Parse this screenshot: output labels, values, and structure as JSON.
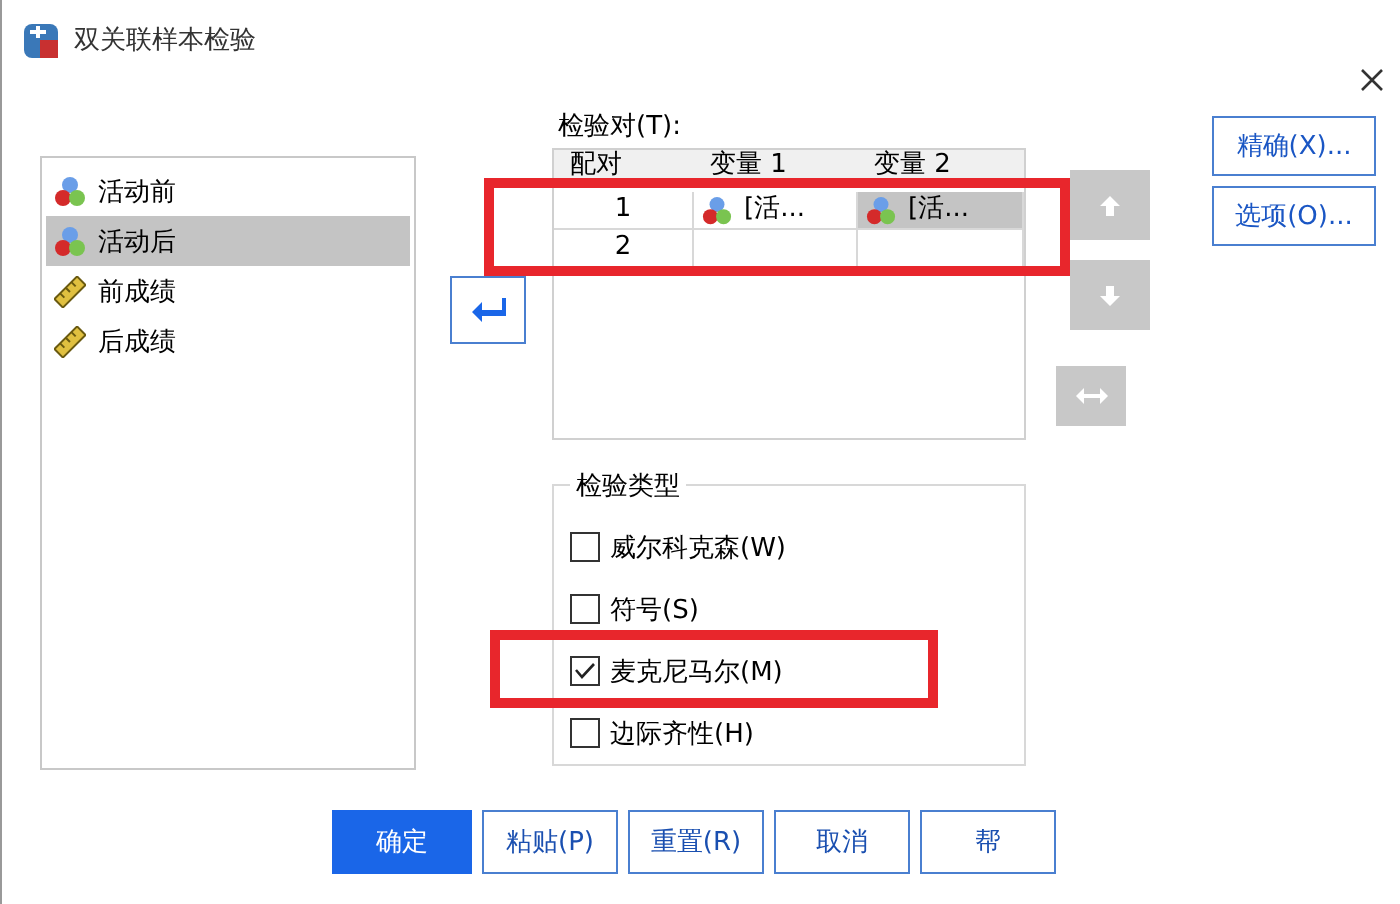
{
  "window": {
    "title": "双关联样本检验"
  },
  "variables": [
    {
      "name": "活动前",
      "kind": "nominal",
      "selected": false
    },
    {
      "name": "活动后",
      "kind": "nominal",
      "selected": true
    },
    {
      "name": "前成绩",
      "kind": "scale",
      "selected": false
    },
    {
      "name": "后成绩",
      "kind": "scale",
      "selected": false
    }
  ],
  "pairs": {
    "label": "检验对(T):",
    "columns": [
      "配对",
      "变量 1",
      "变量 2"
    ],
    "rows": [
      {
        "pair": "1",
        "variable_1": {
          "text": "[活...",
          "selected": false
        },
        "variable_2": {
          "text": "[活...",
          "selected": true
        }
      },
      {
        "pair": "2"
      }
    ]
  },
  "side_buttons": [
    "精确(X)...",
    "选项(O)..."
  ],
  "test_type": {
    "title": "检验类型",
    "options": [
      {
        "label": "威尔科克森(W)",
        "checked": false
      },
      {
        "label": "符号(S)",
        "checked": false
      },
      {
        "label": "麦克尼马尔(M)",
        "checked": true
      },
      {
        "label": "边际齐性(H)",
        "checked": false
      }
    ]
  },
  "buttons": [
    {
      "label": "确定",
      "kind": "primary"
    },
    {
      "label": "粘贴(P)",
      "kind": "normal"
    },
    {
      "label": "重置(R)",
      "kind": "normal"
    },
    {
      "label": "取消",
      "kind": "normal"
    },
    {
      "label": "帮",
      "kind": "normal"
    }
  ]
}
